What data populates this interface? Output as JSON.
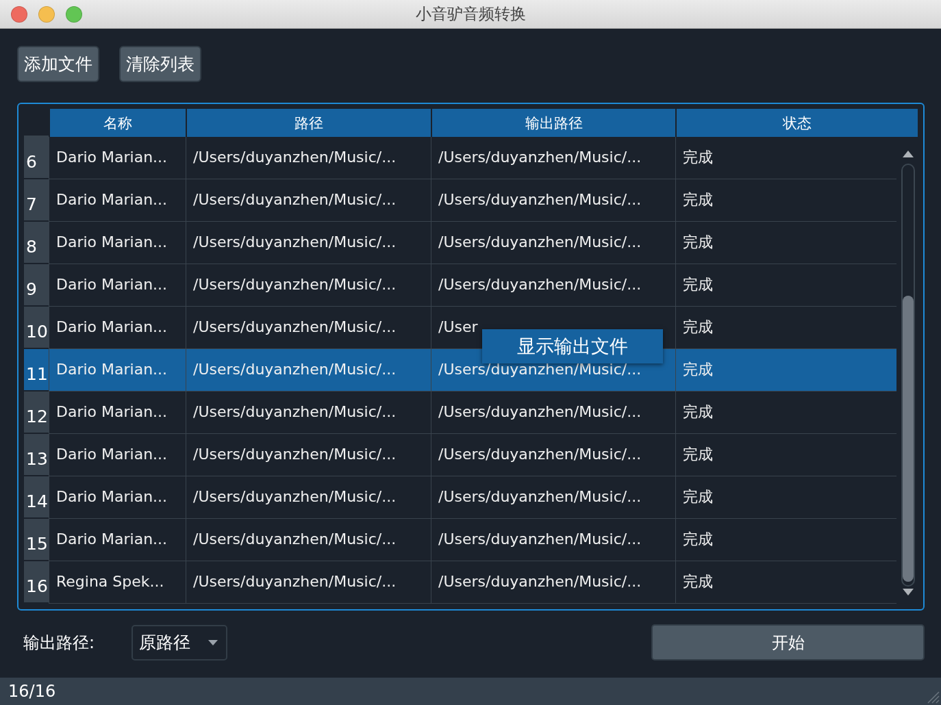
{
  "window": {
    "title": "小音驴音频转换"
  },
  "toolbar": {
    "buttons": [
      "添加文件",
      "清除列表"
    ]
  },
  "table": {
    "columns": [
      "名称",
      "路径",
      "输出路径",
      "状态"
    ],
    "rows": [
      {
        "index": "6",
        "name": "Dario Marian...",
        "path": "/Users/duyanzhen/Music/...",
        "output": "/Users/duyanzhen/Music/...",
        "status": "完成",
        "selected": false
      },
      {
        "index": "7",
        "name": "Dario Marian...",
        "path": "/Users/duyanzhen/Music/...",
        "output": "/Users/duyanzhen/Music/...",
        "status": "完成",
        "selected": false
      },
      {
        "index": "8",
        "name": "Dario Marian...",
        "path": "/Users/duyanzhen/Music/...",
        "output": "/Users/duyanzhen/Music/...",
        "status": "完成",
        "selected": false
      },
      {
        "index": "9",
        "name": "Dario Marian...",
        "path": "/Users/duyanzhen/Music/...",
        "output": "/Users/duyanzhen/Music/...",
        "status": "完成",
        "selected": false
      },
      {
        "index": "10",
        "name": "Dario Marian...",
        "path": "/Users/duyanzhen/Music/...",
        "output": "/User",
        "status": "完成",
        "selected": false
      },
      {
        "index": "11",
        "name": "Dario Marian...",
        "path": "/Users/duyanzhen/Music/...",
        "output": "/Users/duyanzhen/Music/...",
        "status": "完成",
        "selected": true
      },
      {
        "index": "12",
        "name": "Dario Marian...",
        "path": "/Users/duyanzhen/Music/...",
        "output": "/Users/duyanzhen/Music/...",
        "status": "完成",
        "selected": false
      },
      {
        "index": "13",
        "name": "Dario Marian...",
        "path": "/Users/duyanzhen/Music/...",
        "output": "/Users/duyanzhen/Music/...",
        "status": "完成",
        "selected": false
      },
      {
        "index": "14",
        "name": "Dario Marian...",
        "path": "/Users/duyanzhen/Music/...",
        "output": "/Users/duyanzhen/Music/...",
        "status": "完成",
        "selected": false
      },
      {
        "index": "15",
        "name": "Dario Marian...",
        "path": "/Users/duyanzhen/Music/...",
        "output": "/Users/duyanzhen/Music/...",
        "status": "完成",
        "selected": false
      },
      {
        "index": "16",
        "name": "Regina Spek...",
        "path": "/Users/duyanzhen/Music/...",
        "output": "/Users/duyanzhen/Music/...",
        "status": "完成",
        "selected": false
      }
    ]
  },
  "context_menu": {
    "items": [
      "显示输出文件"
    ]
  },
  "output": {
    "label": "输出路径:",
    "value": "原路径"
  },
  "start_button": "开始",
  "status_bar": "16/16"
}
